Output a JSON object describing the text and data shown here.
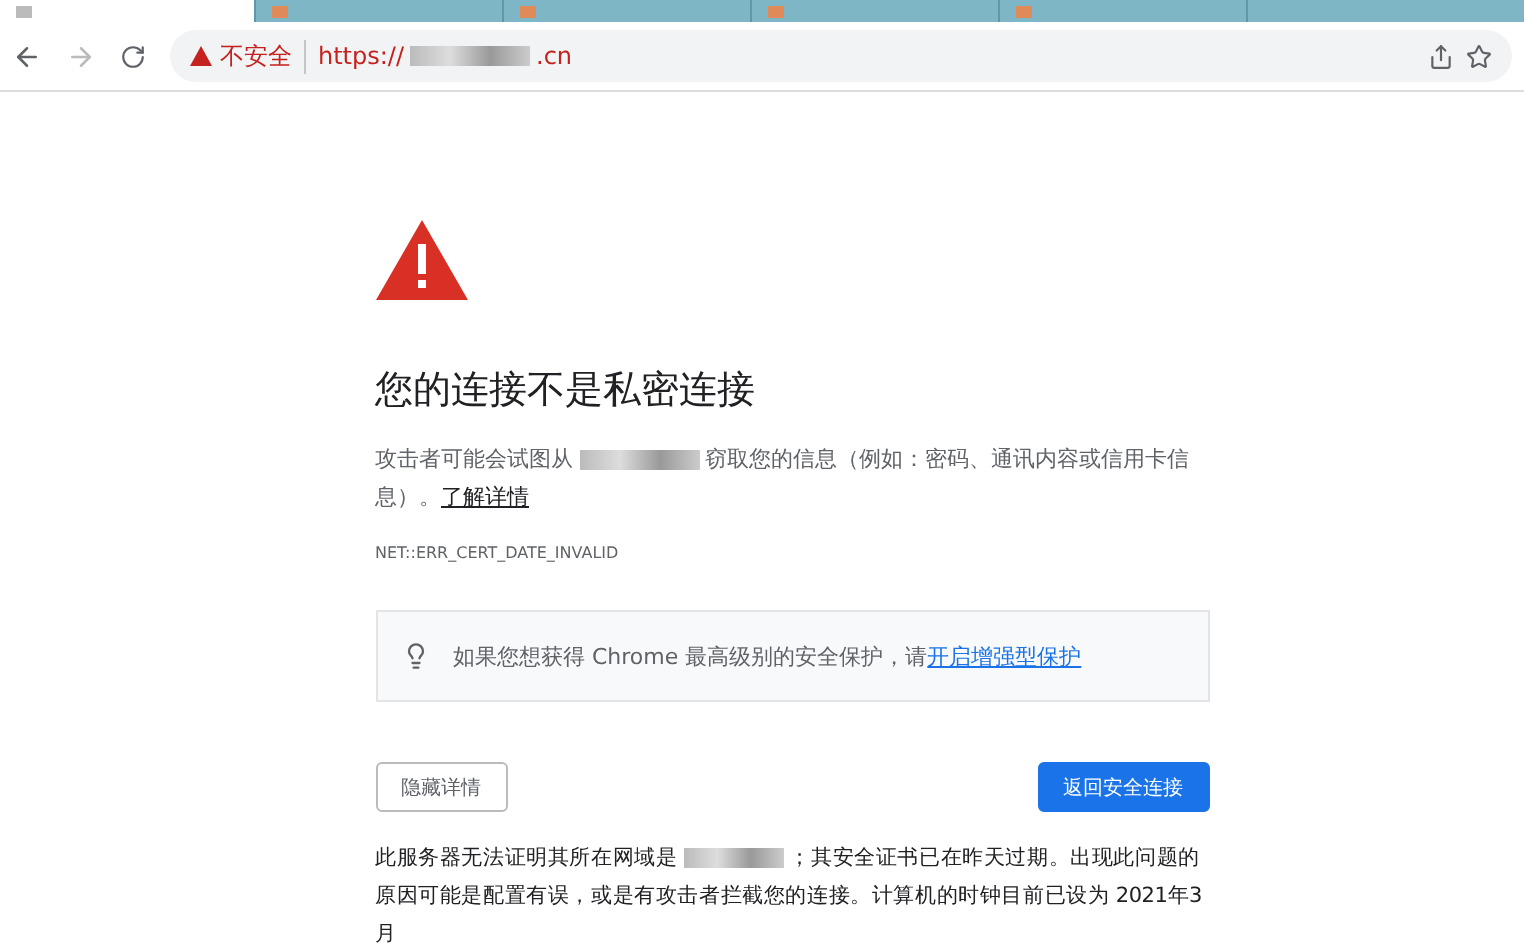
{
  "browser": {
    "tabs": [
      {
        "selected": true
      },
      {
        "selected": false
      },
      {
        "selected": false
      },
      {
        "selected": false
      },
      {
        "selected": false
      }
    ],
    "address_bar": {
      "security_label": "不安全",
      "url_prefix": "https://",
      "url_suffix": ".cn"
    }
  },
  "page": {
    "title": "您的连接不是私密连接",
    "message_before": "攻击者可能会试图从",
    "message_after": "窃取您的信息（例如：密码、通讯内容或信用卡信息）。",
    "learn_more": "了解详情",
    "error_code": "NET::ERR_CERT_DATE_INVALID",
    "protection": {
      "text": "如果您想获得 Chrome 最高级别的安全保护，请",
      "link": "开启增强型保护"
    },
    "buttons": [
      {
        "kind": "secondary",
        "label": "隐藏详情"
      },
      {
        "kind": "primary",
        "label": "返回安全连接"
      }
    ],
    "details_before": "此服务器无法证明其所在网域是",
    "details_after": "；其安全证书已在昨天过期。出现此问题的原因可能是配置有误，或是有攻击者拦截您的连接。计算机的时钟目前已设为 2021年3月"
  }
}
